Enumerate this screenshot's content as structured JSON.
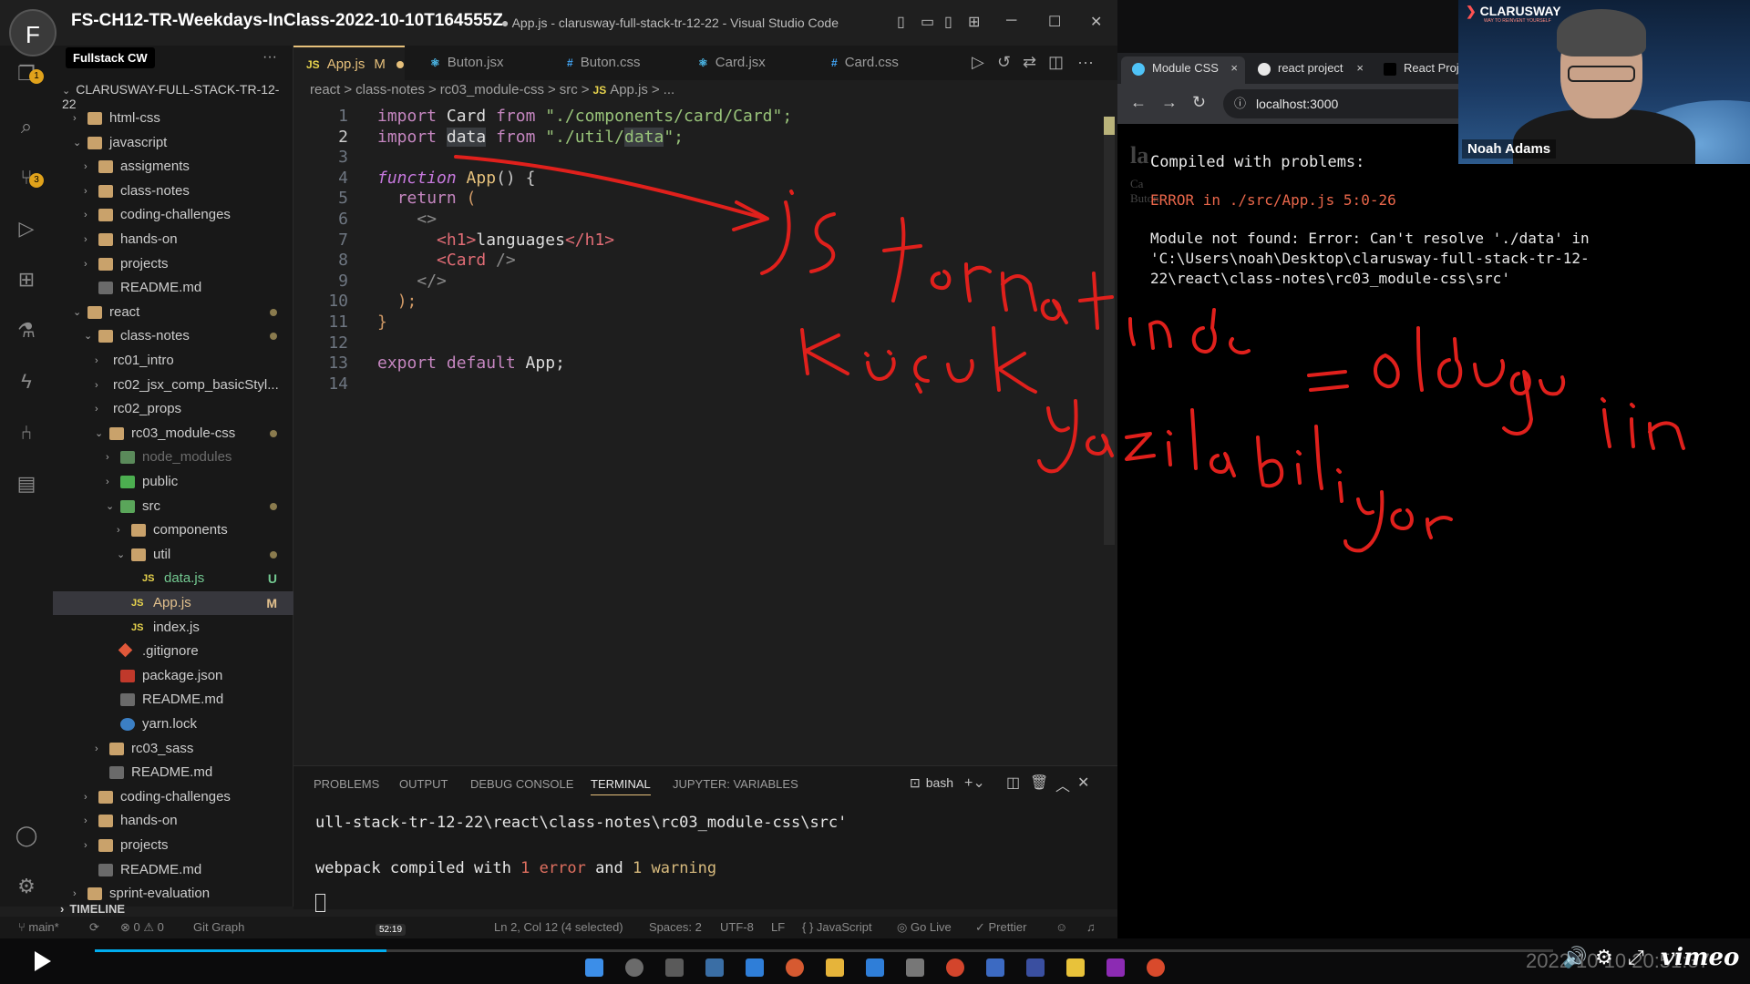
{
  "video": {
    "title": "FS-CH12-TR-Weekdays-InClass-2022-10-10T164555Z",
    "channel_initial": "F",
    "progress_time": "52:19",
    "progress_fraction": 0.2,
    "datetime": "2022 10 10 20:51:37",
    "vimeo": "vimeo"
  },
  "vscode": {
    "window_title": "● App.js - clarusway-full-stack-tr-12-22 - Visual Studio Code",
    "workspace_badge": "Fullstack CW",
    "explorer_root": "CLARUSWAY-FULL-STACK-TR-12-22",
    "tree": [
      {
        "label": "html-css",
        "depth": 1,
        "kind": "folder",
        "open": false
      },
      {
        "label": "javascript",
        "depth": 1,
        "kind": "folder",
        "open": true
      },
      {
        "label": "assigments",
        "depth": 2,
        "kind": "folder",
        "open": false
      },
      {
        "label": "class-notes",
        "depth": 2,
        "kind": "folder",
        "open": false
      },
      {
        "label": "coding-challenges",
        "depth": 2,
        "kind": "folder",
        "open": false
      },
      {
        "label": "hands-on",
        "depth": 2,
        "kind": "folder",
        "open": false
      },
      {
        "label": "projects",
        "depth": 2,
        "kind": "folder",
        "open": false
      },
      {
        "label": "README.md",
        "depth": 2,
        "kind": "md"
      },
      {
        "label": "react",
        "depth": 1,
        "kind": "folder",
        "open": true,
        "dot": true
      },
      {
        "label": "class-notes",
        "depth": 2,
        "kind": "folder",
        "open": true,
        "dot": true
      },
      {
        "label": "rc01_intro",
        "depth": 3,
        "kind": "plain",
        "open": false
      },
      {
        "label": "rc02_jsx_comp_basicStyl...",
        "depth": 3,
        "kind": "plain",
        "open": false
      },
      {
        "label": "rc02_props",
        "depth": 3,
        "kind": "plain",
        "open": false
      },
      {
        "label": "rc03_module-css",
        "depth": 3,
        "kind": "folder",
        "open": true,
        "dot": true
      },
      {
        "label": "node_modules",
        "depth": 4,
        "kind": "nodemod",
        "open": false,
        "dim": true
      },
      {
        "label": "public",
        "depth": 4,
        "kind": "public",
        "open": false
      },
      {
        "label": "src",
        "depth": 4,
        "kind": "src",
        "open": true,
        "dot": true
      },
      {
        "label": "components",
        "depth": 5,
        "kind": "folder",
        "open": false
      },
      {
        "label": "util",
        "depth": 5,
        "kind": "util",
        "open": true,
        "dot": true
      },
      {
        "label": "data.js",
        "depth": 6,
        "kind": "js",
        "mark": "U",
        "mark_color": "#73c991"
      },
      {
        "label": "App.js",
        "depth": 5,
        "kind": "js",
        "mark": "M",
        "mark_color": "#e2c08d",
        "selected": true
      },
      {
        "label": "index.js",
        "depth": 5,
        "kind": "js"
      },
      {
        "label": ".gitignore",
        "depth": 4,
        "kind": "git"
      },
      {
        "label": "package.json",
        "depth": 4,
        "kind": "pkg"
      },
      {
        "label": "README.md",
        "depth": 4,
        "kind": "md"
      },
      {
        "label": "yarn.lock",
        "depth": 4,
        "kind": "yarn"
      },
      {
        "label": "rc03_sass",
        "depth": 3,
        "kind": "folder",
        "open": false
      },
      {
        "label": "README.md",
        "depth": 3,
        "kind": "md"
      },
      {
        "label": "coding-challenges",
        "depth": 2,
        "kind": "folder",
        "open": false
      },
      {
        "label": "hands-on",
        "depth": 2,
        "kind": "folder",
        "open": false
      },
      {
        "label": "projects",
        "depth": 2,
        "kind": "folder",
        "open": false
      },
      {
        "label": "README.md",
        "depth": 2,
        "kind": "md"
      },
      {
        "label": "sprint-evaluation",
        "depth": 1,
        "kind": "folder",
        "open": false
      }
    ],
    "timeline_label": "TIMELINE",
    "tabs": [
      {
        "icon": "JS",
        "label": "App.js",
        "modified": "M",
        "active": true
      },
      {
        "icon": "⚛",
        "label": "Buton.jsx"
      },
      {
        "icon": "#",
        "label": "Buton.css"
      },
      {
        "icon": "⚛",
        "label": "Card.jsx"
      },
      {
        "icon": "#",
        "label": "Card.css"
      }
    ],
    "breadcrumb": [
      "react",
      ">",
      "class-notes",
      ">",
      "rc03_module-css",
      ">",
      "src",
      ">",
      "JS",
      "App.js",
      ">",
      "..."
    ],
    "line_numbers": [
      "1",
      "2",
      "3",
      "4",
      "5",
      "6",
      "7",
      "8",
      "9",
      "10",
      "11",
      "12",
      "13",
      "14"
    ],
    "code": {
      "l1_kw": "import",
      "l1_id": " Card ",
      "l1_from": "from",
      "l1_str": " \"./components/card/Card\";",
      "l2_kw": "import",
      "l2_id": "data",
      "l2_from": "from",
      "l2_q1": " \"",
      "l2_p": "./util/",
      "l2_p2": "data",
      "l2_q2": "\";",
      "l4_kw": "function",
      "l4_fn": " App",
      "l4_rest": "() {",
      "l5_kw": "return",
      "l5_rest": " (",
      "l6": "<>",
      "l7_open": "<h1>",
      "l7_text": "languages",
      "l7_close": "</h1>",
      "l8_tag": "<Card",
      "l8_rest": " />",
      "l9": "</>",
      "l10": ");",
      "l11": "}",
      "l13_kw": "export default",
      "l13_id": " App;"
    },
    "panel": {
      "tabs": [
        "PROBLEMS",
        "OUTPUT",
        "DEBUG CONSOLE",
        "TERMINAL",
        "JUPYTER: VARIABLES"
      ],
      "active_tab": "TERMINAL",
      "shell": "bash",
      "line1": "ull-stack-tr-12-22\\react\\class-notes\\rc03_module-css\\src'",
      "line2_a": "webpack compiled with ",
      "line2_err": "1 error",
      "line2_b": " and ",
      "line2_warn": "1 warning"
    },
    "status": {
      "branch": "main*",
      "problems": "⊗ 0 ⚠ 0",
      "git_graph": "Git Graph",
      "position": "Ln 2, Col 12 (4 selected)",
      "spaces": "Spaces: 2",
      "encoding": "UTF-8",
      "eol": "LF",
      "language": "{ } JavaScript",
      "golive": "Go Live",
      "prettier": "✓ Prettier"
    }
  },
  "browser": {
    "tabs": [
      {
        "label": "Module CSS",
        "close": "×",
        "active": true
      },
      {
        "label": "react project",
        "close": "×"
      },
      {
        "label": "React Proje",
        "close": ""
      }
    ],
    "url": "localhost:3000",
    "behind_heading": "la",
    "behind_lines": [
      "Ca",
      "Buton"
    ],
    "error": {
      "title": "Compiled with problems:",
      "location": "ERROR in ./src/App.js 5:0-26",
      "msg1": "Module not found: Error: Can't resolve './data' in",
      "msg2": "'C:\\Users\\noah\\Desktop\\clarusway-full-stack-tr-12-",
      "msg3": "22\\react\\class-notes\\rc03_module-css\\src'"
    }
  },
  "webcam": {
    "logo": "CLARUSWAY",
    "logo_sub": "WAY TO REINVENT YOURSELF",
    "name": "Noah Adams"
  },
  "colors": {
    "annotation_red": "#e0201c",
    "accent_yellow": "#e6c07b",
    "vimeo_blue": "#00adef"
  }
}
